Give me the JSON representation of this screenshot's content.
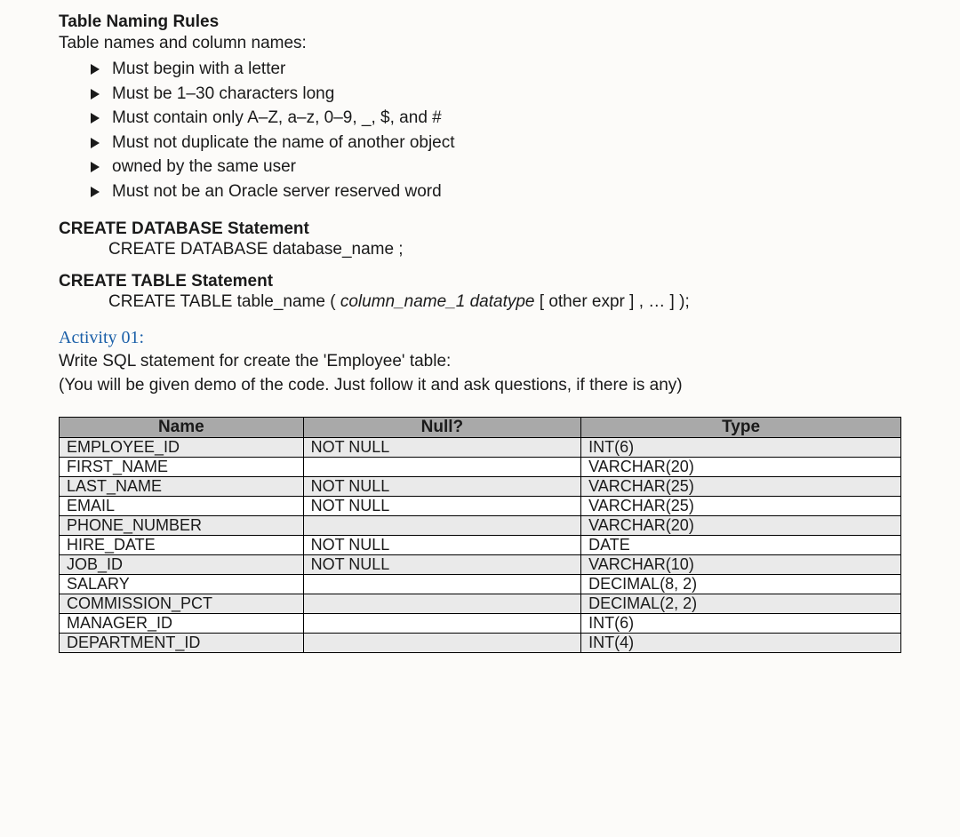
{
  "rules": {
    "title": "Table Naming Rules",
    "intro": "Table names and column names:",
    "items": [
      "Must begin with a letter",
      "Must be 1–30 characters long",
      "Must contain only A–Z, a–z, 0–9, _, $, and #",
      "Must not duplicate the name of another object",
      "owned by the same user",
      "Must not be an Oracle server reserved word"
    ]
  },
  "stmt_db": {
    "title": "CREATE DATABASE Statement",
    "body": "CREATE DATABASE database_name ;"
  },
  "stmt_table": {
    "title": "CREATE TABLE Statement",
    "prefix": "CREATE TABLE table_name ( ",
    "italic": "column_name_1 datatype",
    "suffix": " [ other expr ] , … ] );"
  },
  "activity": {
    "title": "Activity 01:",
    "line1": "Write SQL statement for create the 'Employee' table:",
    "line2": "(You will be given demo of the code. Just follow it and ask questions, if there is any)"
  },
  "table": {
    "headers": {
      "name": "Name",
      "null": "Null?",
      "type": "Type"
    },
    "rows": [
      {
        "name": "EMPLOYEE_ID",
        "null": "NOT NULL",
        "type": "INT(6)"
      },
      {
        "name": "FIRST_NAME",
        "null": "",
        "type": "VARCHAR(20)"
      },
      {
        "name": "LAST_NAME",
        "null": "NOT NULL",
        "type": "VARCHAR(25)"
      },
      {
        "name": "EMAIL",
        "null": "NOT NULL",
        "type": "VARCHAR(25)"
      },
      {
        "name": "PHONE_NUMBER",
        "null": "",
        "type": "VARCHAR(20)"
      },
      {
        "name": "HIRE_DATE",
        "null": "NOT NULL",
        "type": "DATE"
      },
      {
        "name": "JOB_ID",
        "null": "NOT NULL",
        "type": "VARCHAR(10)"
      },
      {
        "name": "SALARY",
        "null": "",
        "type": "DECIMAL(8, 2)"
      },
      {
        "name": "COMMISSION_PCT",
        "null": "",
        "type": "DECIMAL(2, 2)"
      },
      {
        "name": "MANAGER_ID",
        "null": "",
        "type": "INT(6)"
      },
      {
        "name": "DEPARTMENT_ID",
        "null": "",
        "type": "INT(4)"
      }
    ]
  }
}
